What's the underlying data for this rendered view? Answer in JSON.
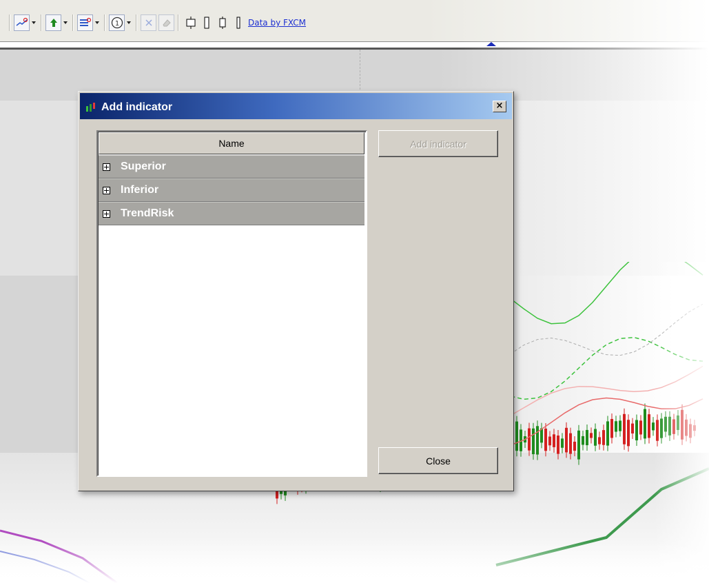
{
  "toolbar": {
    "tools": [
      {
        "name": "draw-line-tool-icon",
        "dropdown": true,
        "boxed": true
      },
      {
        "name": "buy-arrow-icon",
        "dropdown": true,
        "boxed": true
      },
      {
        "name": "indicator-list-icon",
        "dropdown": true,
        "boxed": true
      },
      {
        "name": "number-one-icon",
        "dropdown": true,
        "boxed": true
      },
      {
        "name": "delete-x-icon",
        "dropdown": false,
        "boxed": true
      },
      {
        "name": "eraser-icon",
        "dropdown": false,
        "boxed": true
      },
      {
        "name": "candle-wide-icon",
        "dropdown": false,
        "boxed": false
      },
      {
        "name": "candle-narrow-icon",
        "dropdown": false,
        "boxed": false
      },
      {
        "name": "candle-medium-icon",
        "dropdown": false,
        "boxed": false
      },
      {
        "name": "candle-thin-icon",
        "dropdown": false,
        "boxed": false
      }
    ],
    "data_link": "Data by FXCM"
  },
  "dialog": {
    "title": "Add indicator",
    "column_header": "Name",
    "tree_items": [
      {
        "label": "Superior",
        "expanded": false
      },
      {
        "label": "Inferior",
        "expanded": false
      },
      {
        "label": "TrendRisk",
        "expanded": false
      }
    ],
    "add_button": "Add indicator",
    "add_button_enabled": false,
    "close_button": "Close",
    "close_x": "×"
  },
  "colors": {
    "title_gradient_start": "#0a246a",
    "title_gradient_end": "#a6caf0",
    "dialog_face": "#d4d0c8",
    "row_background": "#a7a6a2",
    "link": "#1c2fd1",
    "bull_candle": "#1e8c1e",
    "bear_candle": "#d42020",
    "indicator_red": "#e86a6a",
    "indicator_green": "#3cc23c"
  }
}
